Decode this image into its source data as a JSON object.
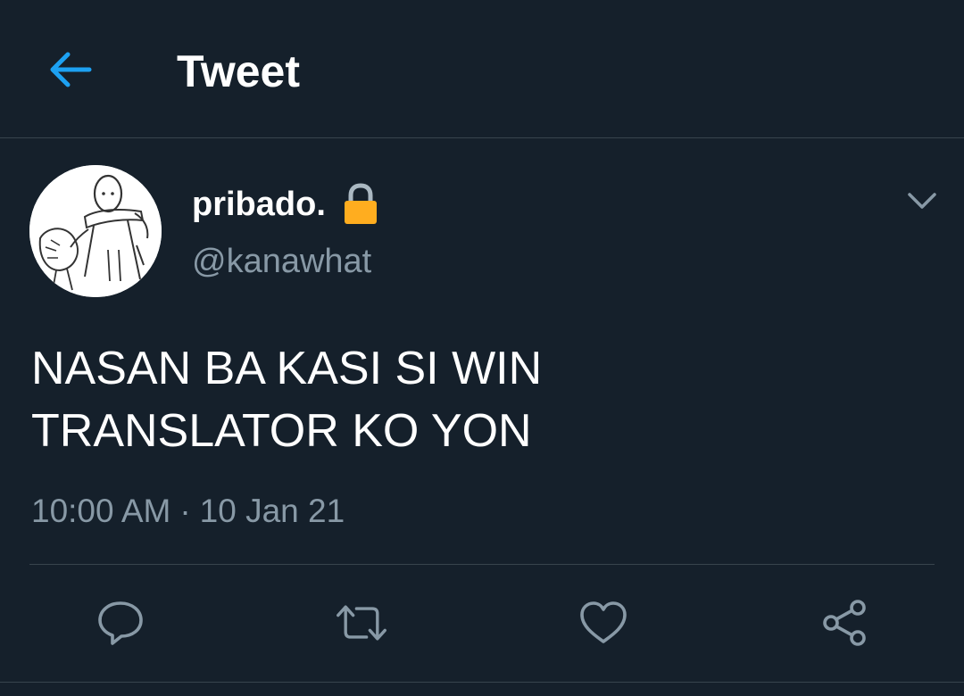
{
  "header": {
    "title": "Tweet",
    "back_icon": "arrow-left-icon"
  },
  "tweet": {
    "display_name": "pribado.",
    "handle": "@kanawhat",
    "protected_icon": "lock-icon",
    "text_lines": [
      "NASAN BA KASI SI WIN",
      "TRANSLATOR KO YON"
    ],
    "time": "10:00 AM",
    "separator": "·",
    "date": "10 Jan 21"
  },
  "actions": [
    {
      "name": "reply",
      "icon": "reply-icon"
    },
    {
      "name": "retweet",
      "icon": "retweet-icon"
    },
    {
      "name": "like",
      "icon": "heart-icon"
    },
    {
      "name": "share",
      "icon": "share-icon"
    }
  ],
  "colors": {
    "background": "#15202b",
    "accent": "#1da1f2",
    "secondary_text": "#8899a6",
    "divider": "#38444d",
    "lock": "#ffad1f"
  }
}
